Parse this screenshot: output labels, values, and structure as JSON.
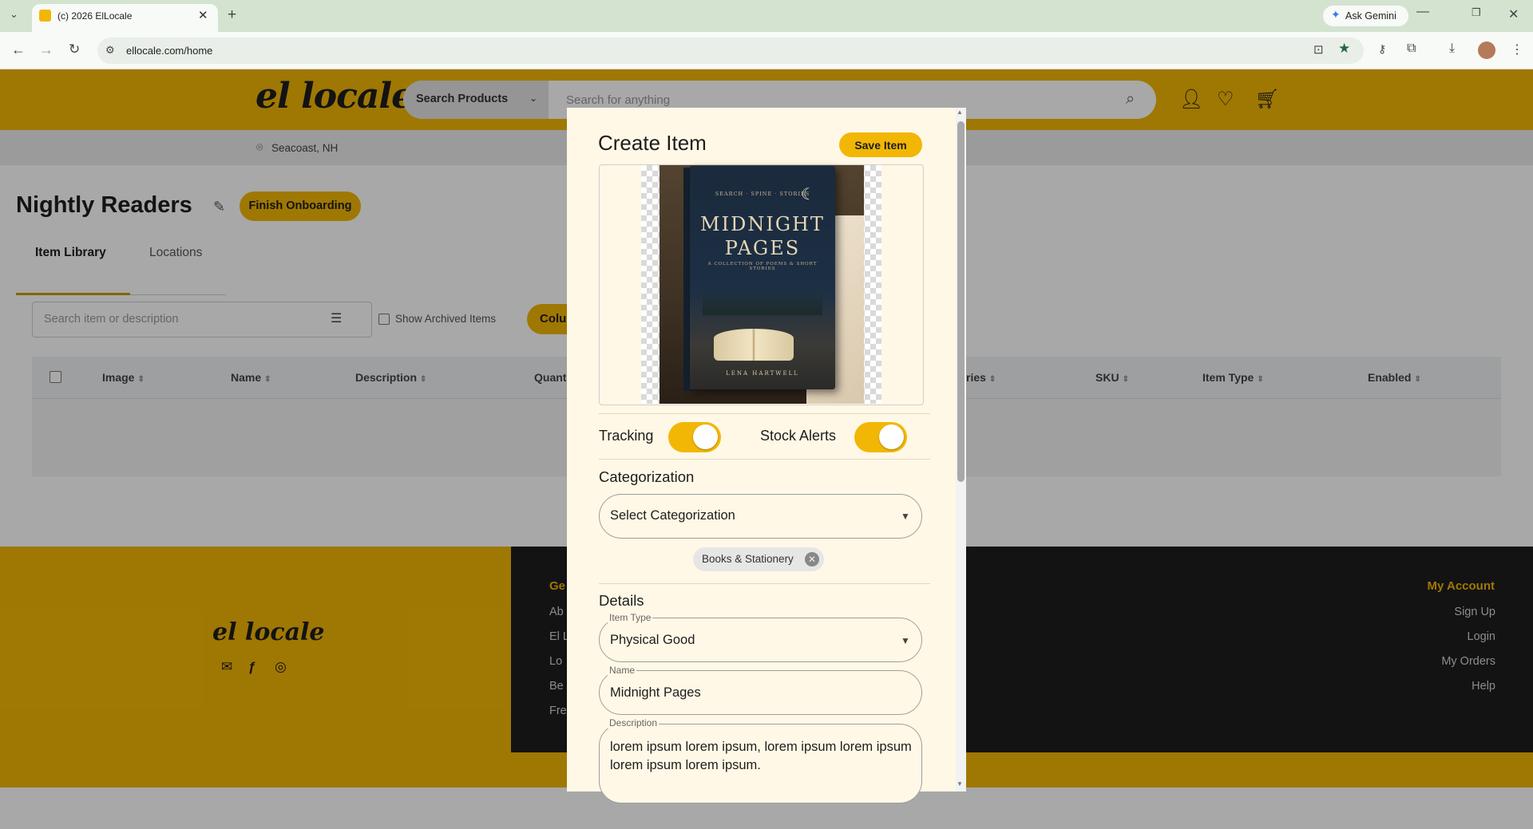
{
  "browser": {
    "tab_title": "(c) 2026 ElLocale",
    "url": "ellocale.com/home",
    "gemini_label": "Ask Gemini"
  },
  "header": {
    "logo": "el locale",
    "search_category": "Search Products",
    "search_placeholder": "Search for anything",
    "location": "Seacoast, NH"
  },
  "page": {
    "title": "Nightly Readers",
    "onboarding_button": "Finish Onboarding",
    "tabs": [
      "Item Library",
      "Locations"
    ],
    "search_placeholder": "Search item or description",
    "archived_label": "Show Archived Items",
    "columns_button": "Colu",
    "table_headers": [
      "Image",
      "Name",
      "Description",
      "Quant",
      "ries",
      "SKU",
      "Item Type",
      "Enabled"
    ]
  },
  "footer": {
    "logo": "el locale",
    "left_column_heading": "Ge",
    "left_links": [
      "Ab",
      "El L",
      "Lo",
      "Be",
      "Fre"
    ],
    "account_heading": "My Account",
    "account_links": [
      "Sign Up",
      "Login",
      "My Orders",
      "Help"
    ]
  },
  "modal": {
    "title": "Create Item",
    "save_button": "Save Item",
    "book": {
      "kicker": "SEARCH · SPINE · STORIES",
      "title_line1": "MIDNIGHT",
      "title_line2": "PAGES",
      "subtitle": "A COLLECTION OF POEMS & SHORT STORIES",
      "author": "LENA HARTWELL"
    },
    "tracking_label": "Tracking",
    "tracking_on": true,
    "stock_alerts_label": "Stock Alerts",
    "stock_alerts_on": true,
    "categorization_heading": "Categorization",
    "categorization_placeholder": "Select Categorization",
    "category_chip": "Books & Stationery",
    "details_heading": "Details",
    "item_type_label": "Item Type",
    "item_type_value": "Physical Good",
    "name_label": "Name",
    "name_value": "Midnight Pages",
    "description_label": "Description",
    "description_value": "lorem ipsum lorem ipsum, lorem ipsum lorem ipsum lorem ipsum lorem ipsum."
  },
  "colors": {
    "brand_yellow": "#f2b705",
    "footer_dark": "#1d1d1d",
    "modal_bg": "#fff8e6"
  }
}
